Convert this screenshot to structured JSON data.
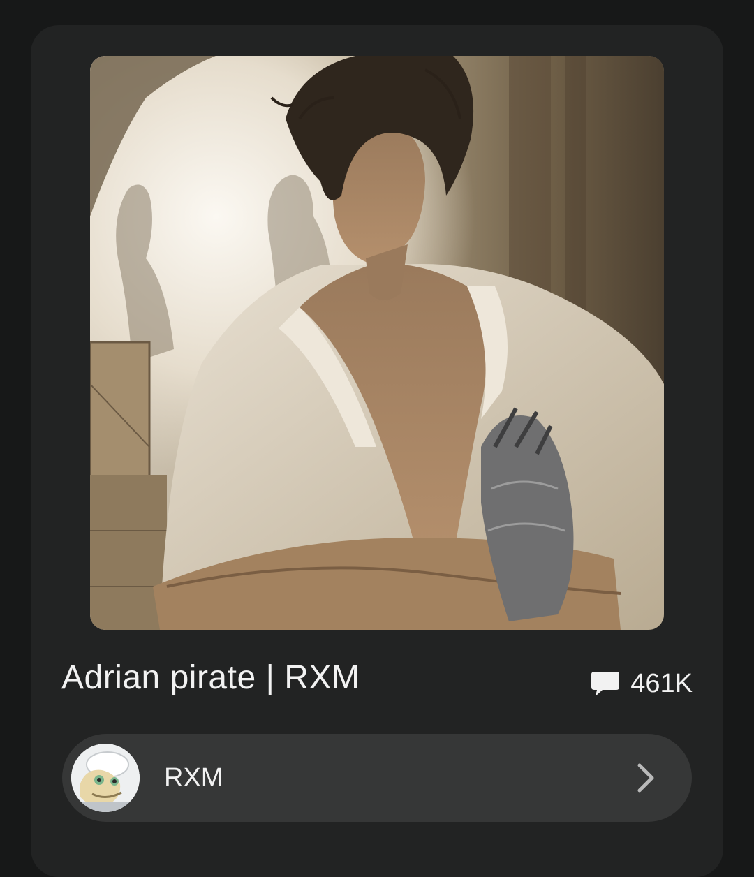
{
  "character": {
    "title": "Adrian pirate | RXM",
    "chat_count": "461K",
    "image": "character-portrait"
  },
  "creator": {
    "name": "RXM",
    "avatar": "creator-avatar"
  },
  "icons": {
    "chat": "chat-bubble-icon",
    "chevron": "chevron-right-icon"
  },
  "colors": {
    "background": "#171818",
    "card": "#222323",
    "pill": "#363737",
    "text": "#f2f2f2",
    "chevron": "#b9b9b9"
  }
}
